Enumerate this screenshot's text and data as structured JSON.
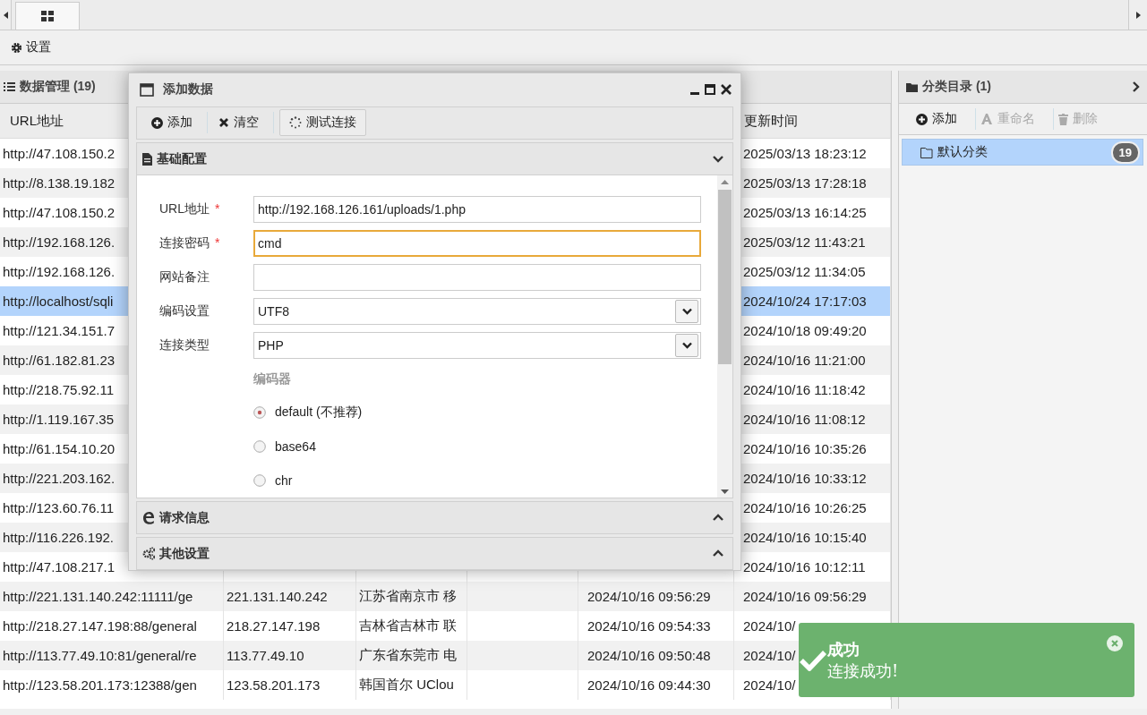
{
  "tab_bar": {
    "tabs": [
      {
        "selected": true
      }
    ]
  },
  "toolbar": {
    "buttons": [
      {
        "label": "设置"
      }
    ]
  },
  "data_panel": {
    "title": "数据管理 (19)",
    "columns": [
      "URL地址",
      "更新时间"
    ],
    "rows": [
      {
        "url": "http://47.108.150.2",
        "updated": "2025/03/13 18:23:12",
        "selected": false
      },
      {
        "url": "http://8.138.19.182",
        "updated": "2025/03/13 17:28:18",
        "selected": false
      },
      {
        "url": "http://47.108.150.2",
        "updated": "2025/03/13 16:14:25",
        "selected": false
      },
      {
        "url": "http://192.168.126.",
        "updated": "2025/03/12 11:43:21",
        "selected": false
      },
      {
        "url": "http://192.168.126.",
        "updated": "2025/03/12 11:34:05",
        "selected": false
      },
      {
        "url": "http://localhost/sqli",
        "updated": "2024/10/24 17:17:03",
        "selected": true
      },
      {
        "url": "http://121.34.151.7",
        "updated": "2024/10/18 09:49:20",
        "selected": false
      },
      {
        "url": "http://61.182.81.23",
        "updated": "2024/10/16 11:21:00",
        "selected": false
      },
      {
        "url": "http://218.75.92.11",
        "updated": "2024/10/16 11:18:42",
        "selected": false
      },
      {
        "url": "http://1.119.167.35",
        "updated": "2024/10/16 11:08:12",
        "selected": false
      },
      {
        "url": "http://61.154.10.20",
        "updated": "2024/10/16 10:35:26",
        "selected": false
      },
      {
        "url": "http://221.203.162.",
        "updated": "2024/10/16 10:33:12",
        "selected": false
      },
      {
        "url": "http://123.60.76.11",
        "updated": "2024/10/16 10:26:25",
        "selected": false
      },
      {
        "url": "http://116.226.192.",
        "updated": "2024/10/16 10:15:40",
        "selected": false
      },
      {
        "url": "http://47.108.217.1",
        "updated": "2024/10/16 10:12:11",
        "selected": false
      },
      {
        "url": "http://221.131.140.242:11111/ge",
        "ip": "221.131.140.242",
        "location": "江苏省南京市 移",
        "created": "2024/10/16 09:56:29",
        "updated": "2024/10/16 09:56:29",
        "selected": false
      },
      {
        "url": "http://218.27.147.198:88/general",
        "ip": "218.27.147.198",
        "location": "吉林省吉林市 联",
        "created": "2024/10/16 09:54:33",
        "updated": "2024/10/",
        "selected": false
      },
      {
        "url": "http://113.77.49.10:81/general/re",
        "ip": "113.77.49.10",
        "location": "广东省东莞市 电",
        "created": "2024/10/16 09:50:48",
        "updated": "2024/10/",
        "selected": false
      },
      {
        "url": "http://123.58.201.173:12388/gen",
        "ip": "123.58.201.173",
        "location": "韩国首尔 UClou",
        "created": "2024/10/16 09:44:30",
        "updated": "2024/10/",
        "selected": false
      }
    ]
  },
  "category_panel": {
    "title": "分类目录 (1)",
    "buttons": [
      {
        "label": "添加",
        "disabled": false
      },
      {
        "label": "重命名",
        "disabled": true
      },
      {
        "label": "删除",
        "disabled": true
      }
    ],
    "items": [
      {
        "label": "默认分类",
        "count": "19",
        "selected": true
      }
    ]
  },
  "dialog": {
    "title": "添加数据",
    "buttons": [
      {
        "label": "添加",
        "highlighted": false
      },
      {
        "label": "清空",
        "highlighted": false
      },
      {
        "label": "测试连接",
        "highlighted": true
      }
    ],
    "sections": [
      {
        "title": "基础配置",
        "expanded": true
      },
      {
        "title": "请求信息",
        "expanded": false
      },
      {
        "title": "其他设置",
        "expanded": false
      }
    ],
    "fields": [
      {
        "kind": "text",
        "label": "URL地址",
        "required_mark": "*",
        "value": "http://192.168.126.161/uploads/1.php",
        "focused": false
      },
      {
        "kind": "text",
        "label": "连接密码",
        "required_mark": "*",
        "value": "cmd",
        "focused": true
      },
      {
        "kind": "text",
        "label": "网站备注",
        "focused": false
      },
      {
        "kind": "select",
        "label": "编码设置",
        "value": "UTF8"
      },
      {
        "kind": "select",
        "label": "连接类型",
        "value": "PHP"
      }
    ],
    "encoder": {
      "label": "编码器",
      "options": [
        {
          "label": "default (不推荐)",
          "selected": true
        },
        {
          "label": "base64",
          "selected": false
        },
        {
          "label": "chr",
          "selected": false
        }
      ]
    }
  },
  "toast": {
    "title": "成功",
    "message": "连接成功!"
  }
}
